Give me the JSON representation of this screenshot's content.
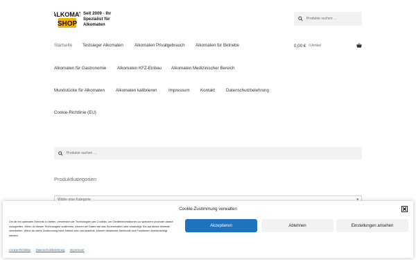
{
  "header": {
    "logo_text": "ALKOMAT SHOP",
    "tagline": "Seit 2009 - Ihr Spezialist für Alkomaten",
    "search_placeholder": "Produkte suchen …"
  },
  "nav": {
    "items": [
      {
        "label": "Startseite"
      },
      {
        "label": "Testsieger Alkomaten"
      },
      {
        "label": "Alkomaten Privatgebrauch"
      },
      {
        "label": "Alkomaten für Betriebe"
      },
      {
        "label": "Alkomaten für Gastronomie"
      },
      {
        "label": "Alkomaten KFZ-Einbau"
      },
      {
        "label": "Alkomaten Medizinischer Bereich"
      },
      {
        "label": "Mundstücke für Alkomaten"
      },
      {
        "label": "Alkomaten kalibrieren"
      },
      {
        "label": "Impressum"
      },
      {
        "label": "Kontakt"
      },
      {
        "label": "Datenschutzbelehrung"
      },
      {
        "label": "Cookie-Richtlinie (EU)"
      }
    ]
  },
  "cart": {
    "amount": "0,00 €",
    "count": "0 Artikel",
    "icon": "basket-icon"
  },
  "main": {
    "search_placeholder": "Produkte suchen …",
    "categories_heading": "Produktkategorien",
    "category_select": "Wähle eine Kategorie"
  },
  "cookie": {
    "title": "Cookie-Zustimmung verwalten",
    "text": "Um dir ein optimales Erlebnis zu bieten, verwenden wir Technologien wie Cookies, um Geräteinformationen zu speichern und/oder darauf zuzugreifen. Wenn du diesen Technologien zustimmst, können wir Daten wie das Surfverhalten oder eindeutige IDs auf dieser Website verarbeiten. Wenn du deine Zustimmung nicht erteilst oder zurückziehst, können bestimmte Merkmale und Funktionen beeinträchtigt werden.",
    "accept": "Akzeptieren",
    "deny": "Ablehnen",
    "preferences": "Einstellungen ansehen",
    "links": [
      "Cookie-Richtlinie",
      "Datenschutzbelehrung",
      "Impressum"
    ]
  },
  "colors": {
    "accent": "#1e73be",
    "text": "#333333",
    "muted": "#6d6d6d",
    "input_bg": "#f2f2f2"
  }
}
